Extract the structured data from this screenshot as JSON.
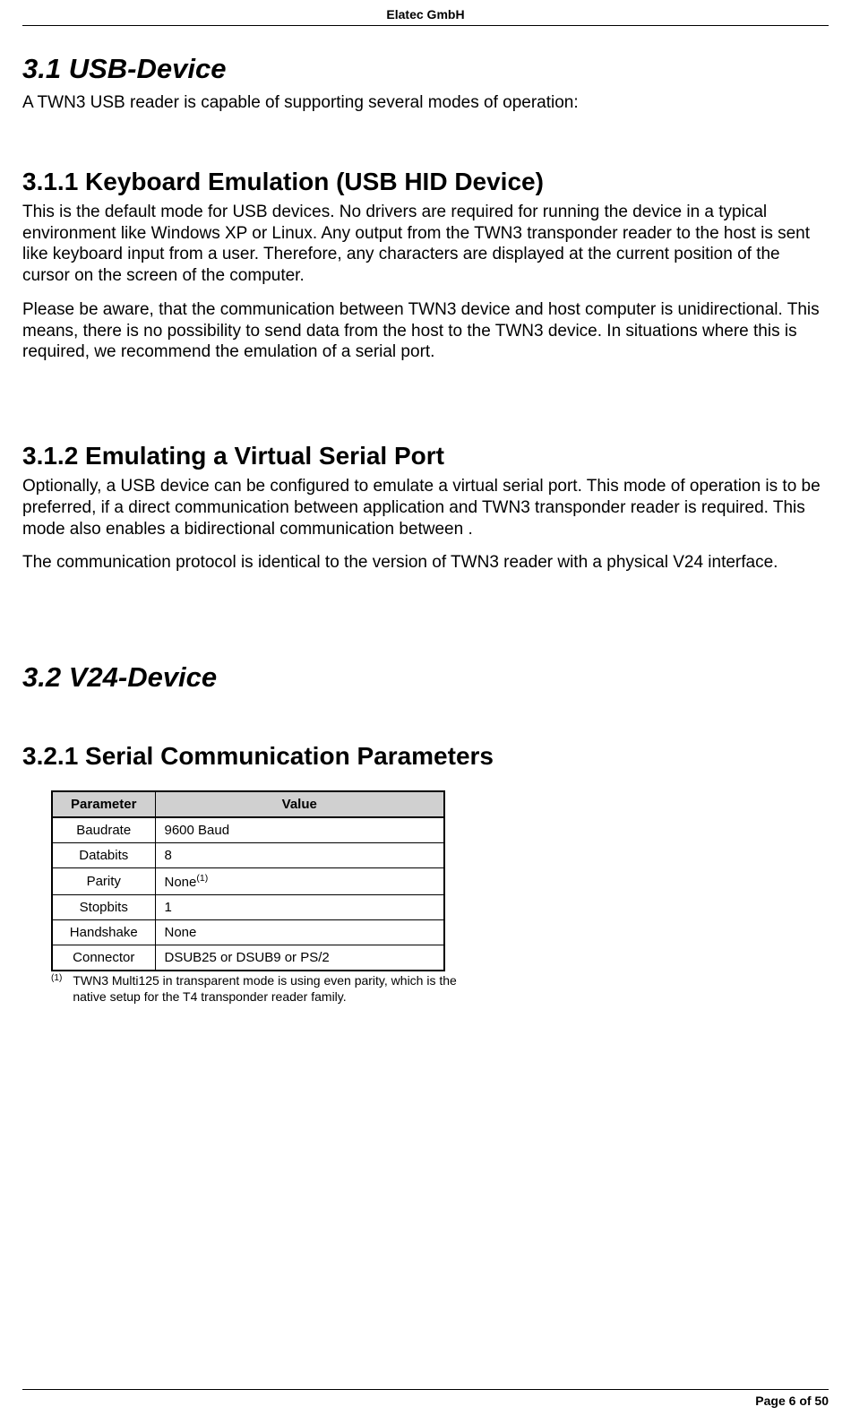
{
  "header": {
    "company": "Elatec GmbH"
  },
  "sec31": {
    "title": "3.1  USB-Device",
    "intro": "A TWN3 USB reader is capable of supporting several modes of operation:"
  },
  "sec311": {
    "title": "3.1.1  Keyboard Emulation (USB HID Device)",
    "p1": "This is the default mode for USB devices. No drivers are required for running the device in a typical environment like Windows XP or Linux. Any output from the TWN3 transponder reader to the host is sent like keyboard input from a user. Therefore, any characters are displayed at the current position of the cursor on the screen of the computer.",
    "p2": "Please be aware, that the communication between TWN3 device and host computer is unidirectional. This means, there is no possibility to send data from the host to the TWN3 device. In situations where this is required, we recommend the emulation of a serial port."
  },
  "sec312": {
    "title": "3.1.2  Emulating a Virtual Serial Port",
    "p1": "Optionally, a USB device can be configured to emulate a virtual serial port. This mode of operation is to be preferred, if a direct communication between application and TWN3 transponder reader is required. This mode also enables a bidirectional communication between .",
    "p2": "The communication protocol is identical to the version of TWN3 reader with a physical V24 interface."
  },
  "sec32": {
    "title": "3.2  V24-Device"
  },
  "sec321": {
    "title": "3.2.1  Serial Communication Parameters"
  },
  "table": {
    "headers": {
      "param": "Parameter",
      "value": "Value"
    },
    "rows": [
      {
        "param": "Baudrate",
        "value": "9600 Baud",
        "sup": ""
      },
      {
        "param": "Databits",
        "value": "8",
        "sup": ""
      },
      {
        "param": "Parity",
        "value": "None",
        "sup": "(1)"
      },
      {
        "param": "Stopbits",
        "value": "1",
        "sup": ""
      },
      {
        "param": "Handshake",
        "value": "None",
        "sup": ""
      },
      {
        "param": "Connector",
        "value": "DSUB25 or DSUB9 or PS/2",
        "sup": ""
      }
    ]
  },
  "footnote": {
    "mark": "(1)",
    "text": "TWN3 Multi125 in transparent mode is using even parity, which is the native setup for the T4 transponder reader family."
  },
  "footer": {
    "text": "Page 6 of 50"
  }
}
